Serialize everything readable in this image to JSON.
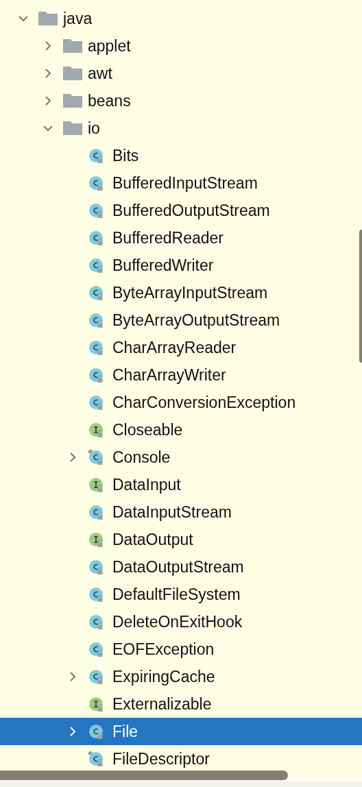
{
  "tree": [
    {
      "label": "java",
      "kind": "folder",
      "expanded": true,
      "selected": false,
      "children": [
        {
          "label": "applet",
          "kind": "folder",
          "expanded": false,
          "selected": false
        },
        {
          "label": "awt",
          "kind": "folder",
          "expanded": false,
          "selected": false
        },
        {
          "label": "beans",
          "kind": "folder",
          "expanded": false,
          "selected": false
        },
        {
          "label": "io",
          "kind": "folder",
          "expanded": true,
          "selected": false,
          "children": [
            {
              "label": "Bits",
              "kind": "class",
              "selected": false
            },
            {
              "label": "BufferedInputStream",
              "kind": "class",
              "selected": false
            },
            {
              "label": "BufferedOutputStream",
              "kind": "class",
              "selected": false
            },
            {
              "label": "BufferedReader",
              "kind": "class",
              "selected": false
            },
            {
              "label": "BufferedWriter",
              "kind": "class",
              "selected": false
            },
            {
              "label": "ByteArrayInputStream",
              "kind": "class",
              "selected": false
            },
            {
              "label": "ByteArrayOutputStream",
              "kind": "class",
              "selected": false
            },
            {
              "label": "CharArrayReader",
              "kind": "class",
              "selected": false
            },
            {
              "label": "CharArrayWriter",
              "kind": "class",
              "selected": false
            },
            {
              "label": "CharConversionException",
              "kind": "class",
              "selected": false
            },
            {
              "label": "Closeable",
              "kind": "interface",
              "selected": false
            },
            {
              "label": "Console",
              "kind": "class-pinned",
              "expanded": false,
              "selected": false
            },
            {
              "label": "DataInput",
              "kind": "interface",
              "selected": false
            },
            {
              "label": "DataInputStream",
              "kind": "class",
              "selected": false
            },
            {
              "label": "DataOutput",
              "kind": "interface",
              "selected": false
            },
            {
              "label": "DataOutputStream",
              "kind": "class",
              "selected": false
            },
            {
              "label": "DefaultFileSystem",
              "kind": "class",
              "selected": false
            },
            {
              "label": "DeleteOnExitHook",
              "kind": "class",
              "selected": false
            },
            {
              "label": "EOFException",
              "kind": "class",
              "selected": false
            },
            {
              "label": "ExpiringCache",
              "kind": "class",
              "expanded": false,
              "selected": false
            },
            {
              "label": "Externalizable",
              "kind": "interface",
              "selected": false
            },
            {
              "label": "File",
              "kind": "class",
              "expanded": false,
              "selected": true
            },
            {
              "label": "FileDescriptor",
              "kind": "class-pinned",
              "selected": false
            }
          ]
        }
      ]
    }
  ]
}
